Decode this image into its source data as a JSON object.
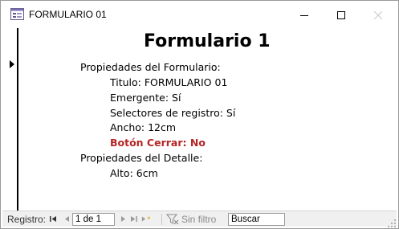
{
  "window": {
    "title": "FORMULARIO 01",
    "icons": {
      "app": "access-form-icon",
      "minimize": "minimize-icon",
      "maximize": "maximize-icon",
      "close": "close-icon"
    }
  },
  "form": {
    "heading": "Formulario 1",
    "lines": [
      "Propiedades del Formulario:",
      "Titulo: FORMULARIO 01",
      "Emergente: Sí",
      "Selectores de registro: Sí",
      "Ancho: 12cm",
      "Botón Cerrar: No",
      "Propiedades del Detalle:",
      "Alto: 6cm"
    ],
    "highlight_color": "#b52626"
  },
  "navigation": {
    "label": "Registro:",
    "record_value": "1 de 1",
    "filter_label": "Sin filtro",
    "search_value": "Buscar"
  }
}
